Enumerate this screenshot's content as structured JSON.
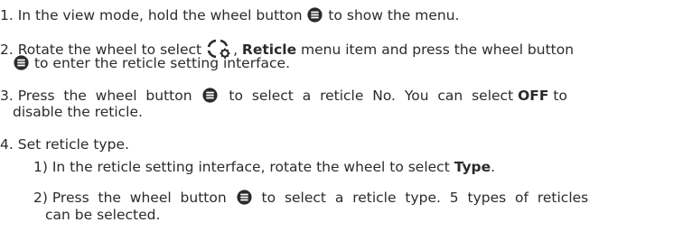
{
  "steps": [
    {
      "num": "1.",
      "parts": [
        "In the view mode, hold the wheel button",
        "to show the menu."
      ]
    },
    {
      "num": "2.",
      "parts": [
        "Rotate the wheel to select",
        ", ",
        "Reticle",
        " menu item  and press the wheel button",
        "to enter the reticle setting interface."
      ]
    },
    {
      "num": "3.",
      "parts": [
        "Press  the  wheel  button",
        "to  select  a  reticle  No.  You  can  select",
        "OFF",
        "to",
        "disable the reticle."
      ]
    },
    {
      "num": "4.",
      "parts": [
        "Set reticle type."
      ]
    }
  ],
  "substeps": [
    {
      "num": "1)",
      "parts": [
        "In the reticle setting interface, rotate the wheel to select",
        "Type",
        "."
      ]
    },
    {
      "num": "2)",
      "parts": [
        "Press  the  wheel  button",
        "to  select  a  reticle  type.  5  types  of  reticles",
        "can be selected."
      ]
    }
  ],
  "icons": {
    "wheel_button": "wheel-button-icon",
    "reticle": "reticle-gear-icon"
  },
  "colors": {
    "text": "#2b2b2b"
  }
}
